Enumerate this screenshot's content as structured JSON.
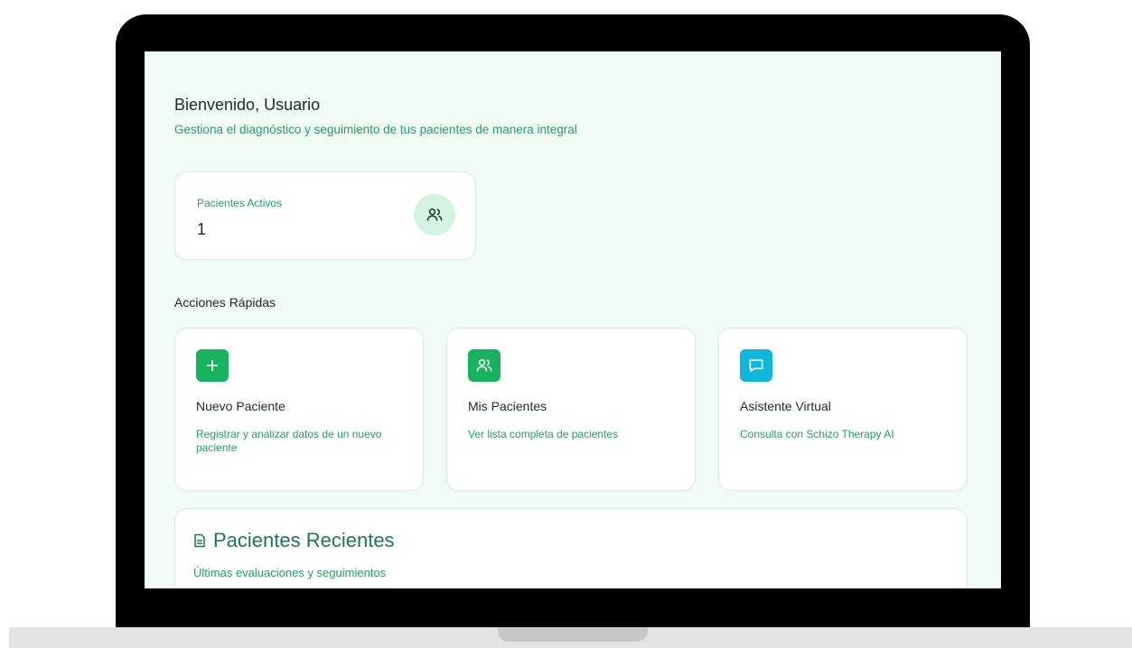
{
  "header": {
    "greeting": "Bienvenido, Usuario",
    "subtitle": "Gestiona el diagnóstico y seguimiento de tus pacientes de manera integral"
  },
  "stats": {
    "active_patients_label": "Pacientes Activos",
    "active_patients_value": "1",
    "icon": "users-icon"
  },
  "quick_actions": {
    "title": "Acciones Rápidas",
    "items": [
      {
        "title": "Nuevo Paciente",
        "description": "Registrar y analizar datos de un nuevo paciente",
        "icon": "plus-icon",
        "color": "#17b35f"
      },
      {
        "title": "Mis Pacientes",
        "description": "Ver lista completa de pacientes",
        "icon": "users-icon",
        "color": "#17b35f"
      },
      {
        "title": "Asistente Virtual",
        "description": "Consulta con Schizo Therapy AI",
        "icon": "chat-icon",
        "color": "#10b7dd"
      }
    ]
  },
  "recent": {
    "title": "Pacientes Recientes",
    "subtitle": "Últimas evaluaciones y seguimientos",
    "icon": "document-icon"
  },
  "colors": {
    "accent_green": "#22a060",
    "button_green": "#17b35f",
    "button_cyan": "#10b7dd",
    "screen_bg": "#f0fbf6"
  }
}
